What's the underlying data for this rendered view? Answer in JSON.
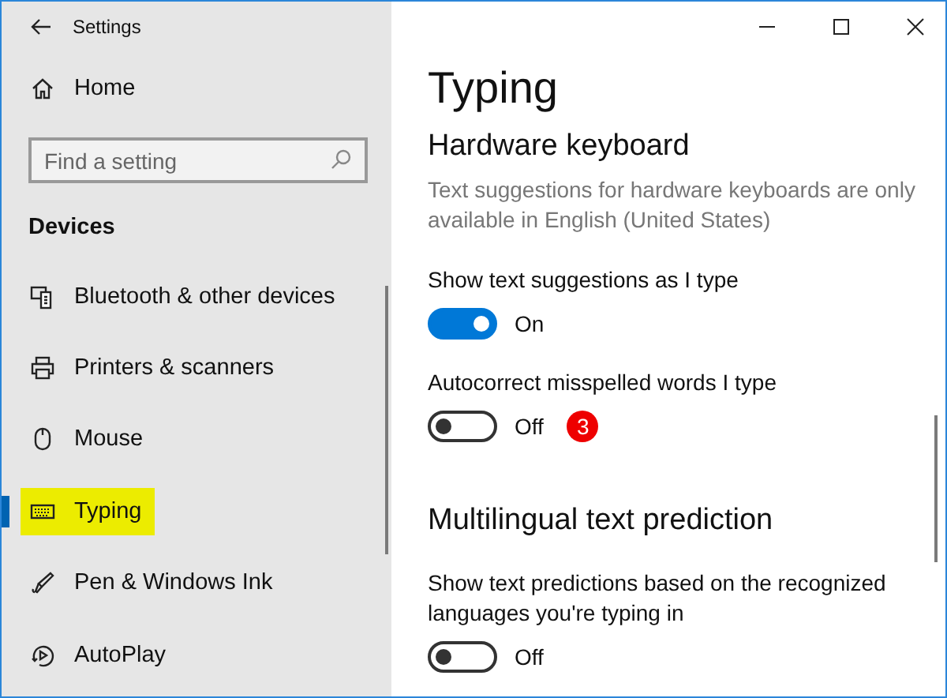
{
  "window": {
    "title": "Settings"
  },
  "sidebar": {
    "home": "Home",
    "search": {
      "placeholder": "Find a setting"
    },
    "section": "Devices",
    "items": [
      {
        "label": "Bluetooth & other devices",
        "selected": false,
        "highlighted": false
      },
      {
        "label": "Printers & scanners",
        "selected": false,
        "highlighted": false
      },
      {
        "label": "Mouse",
        "selected": false,
        "highlighted": false
      },
      {
        "label": "Typing",
        "selected": true,
        "highlighted": true
      },
      {
        "label": "Pen & Windows Ink",
        "selected": false,
        "highlighted": false
      },
      {
        "label": "AutoPlay",
        "selected": false,
        "highlighted": false
      }
    ]
  },
  "page": {
    "title": "Typing",
    "sections": [
      {
        "heading": "Hardware keyboard",
        "settings": [
          {
            "kind": "note",
            "text": "Text suggestions for hardware keyboards are only available in English (United States)"
          },
          {
            "kind": "toggle",
            "label": "Show text suggestions as I type",
            "on": true,
            "state_text": "On"
          },
          {
            "kind": "toggle",
            "label": "Autocorrect misspelled words I type",
            "on": false,
            "state_text": "Off",
            "badge": "3"
          }
        ]
      },
      {
        "heading": "Multilingual text prediction",
        "settings": [
          {
            "kind": "toggle",
            "label": "Show text predictions based on the recognized languages you're typing in",
            "on": false,
            "state_text": "Off"
          }
        ]
      }
    ]
  }
}
